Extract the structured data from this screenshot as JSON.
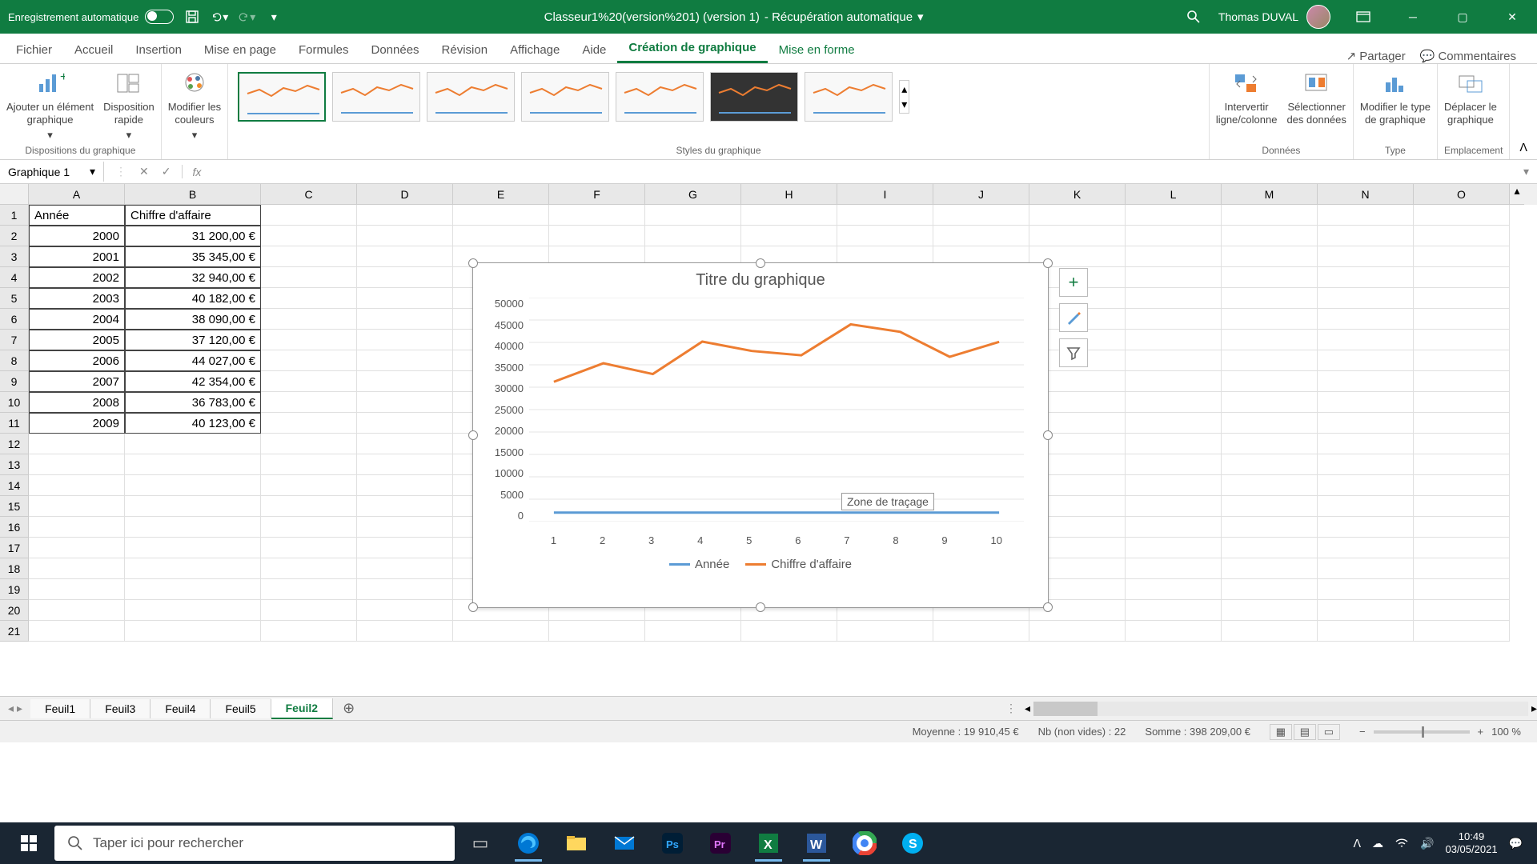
{
  "titlebar": {
    "auto_save": "Enregistrement automatique",
    "doc_name": "Classeur1%20(version%201) (version 1)",
    "doc_suffix": " - Récupération automatique",
    "user": "Thomas DUVAL"
  },
  "ribbon_tabs": {
    "t0": "Fichier",
    "t1": "Accueil",
    "t2": "Insertion",
    "t3": "Mise en page",
    "t4": "Formules",
    "t5": "Données",
    "t6": "Révision",
    "t7": "Affichage",
    "t8": "Aide",
    "t9": "Création de graphique",
    "t10": "Mise en forme",
    "share": "Partager",
    "comments": "Commentaires"
  },
  "ribbon": {
    "g1": {
      "label": "Dispositions du graphique",
      "i1": "Ajouter un élément\ngraphique",
      "i2": "Disposition\nrapide"
    },
    "g2": {
      "i1": "Modifier les\ncouleurs"
    },
    "g3": {
      "label": "Styles du graphique"
    },
    "g4": {
      "label": "Données",
      "i1": "Intervertir\nligne/colonne",
      "i2": "Sélectionner\ndes données"
    },
    "g5": {
      "label": "Type",
      "i1": "Modifier le type\nde graphique"
    },
    "g6": {
      "label": "Emplacement",
      "i1": "Déplacer le\ngraphique"
    }
  },
  "name_box": "Graphique 1",
  "columns": [
    "A",
    "B",
    "C",
    "D",
    "E",
    "F",
    "G",
    "H",
    "I",
    "J",
    "K",
    "L",
    "M",
    "N",
    "O"
  ],
  "rows": [
    "1",
    "2",
    "3",
    "4",
    "5",
    "6",
    "7",
    "8",
    "9",
    "10",
    "11",
    "12",
    "13",
    "14",
    "15",
    "16",
    "17",
    "18",
    "19",
    "20",
    "21"
  ],
  "data": {
    "h1": "Année",
    "h2": "Chiffre d'affaire",
    "r": [
      [
        "2000",
        "31 200,00 €"
      ],
      [
        "2001",
        "35 345,00 €"
      ],
      [
        "2002",
        "32 940,00 €"
      ],
      [
        "2003",
        "40 182,00 €"
      ],
      [
        "2004",
        "38 090,00 €"
      ],
      [
        "2005",
        "37 120,00 €"
      ],
      [
        "2006",
        "44 027,00 €"
      ],
      [
        "2007",
        "42 354,00 €"
      ],
      [
        "2008",
        "36 783,00 €"
      ],
      [
        "2009",
        "40 123,00 €"
      ]
    ]
  },
  "chart": {
    "title": "Titre du graphique",
    "y_ticks": [
      "50000",
      "45000",
      "40000",
      "35000",
      "30000",
      "25000",
      "20000",
      "15000",
      "10000",
      "5000",
      "0"
    ],
    "x_ticks": [
      "1",
      "2",
      "3",
      "4",
      "5",
      "6",
      "7",
      "8",
      "9",
      "10"
    ],
    "legend1": "Année",
    "legend2": "Chiffre d'affaire",
    "tooltip": "Zone de traçage"
  },
  "chart_data": {
    "type": "line",
    "title": "Titre du graphique",
    "categories": [
      1,
      2,
      3,
      4,
      5,
      6,
      7,
      8,
      9,
      10
    ],
    "series": [
      {
        "name": "Année",
        "values": [
          2000,
          2001,
          2002,
          2003,
          2004,
          2005,
          2006,
          2007,
          2008,
          2009
        ],
        "color": "#5b9bd5"
      },
      {
        "name": "Chiffre d'affaire",
        "values": [
          31200,
          35345,
          32940,
          40182,
          38090,
          37120,
          44027,
          42354,
          36783,
          40123
        ],
        "color": "#ed7d31"
      }
    ],
    "ylim": [
      0,
      50000
    ],
    "gridlines": [
      0,
      5000,
      10000,
      15000,
      20000,
      25000,
      30000,
      35000,
      40000,
      45000,
      50000
    ]
  },
  "sheets": {
    "s1": "Feuil1",
    "s2": "Feuil3",
    "s3": "Feuil4",
    "s4": "Feuil5",
    "s5": "Feuil2"
  },
  "status": {
    "avg": "Moyenne : 19 910,45 €",
    "count": "Nb (non vides) : 22",
    "sum": "Somme : 398 209,00 €",
    "zoom": "100 %"
  },
  "taskbar": {
    "search": "Taper ici pour rechercher",
    "time": "10:49",
    "date": "03/05/2021"
  }
}
